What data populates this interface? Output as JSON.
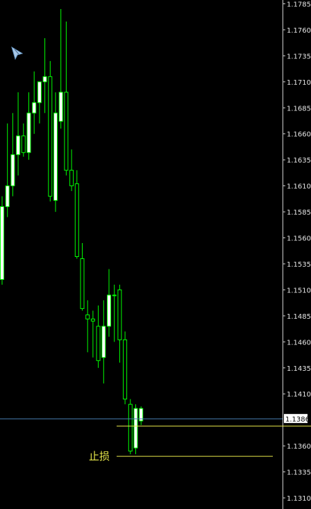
{
  "chart_data": {
    "type": "candlestick",
    "ylim": [
      1.13,
      1.179
    ],
    "y_ticks": [
      "1.1785",
      "1.1760",
      "1.1735",
      "1.1710",
      "1.1685",
      "1.1660",
      "1.1635",
      "1.1610",
      "1.1585",
      "1.1560",
      "1.1535",
      "1.1510",
      "1.1485",
      "1.1460",
      "1.1435",
      "1.1410",
      "1.1386",
      "1.1360",
      "1.1335",
      "1.1310"
    ],
    "current_price": "1.1386",
    "stop_loss_label": "止损",
    "stop_loss_price": 1.135,
    "horizontal_line_price": 1.1379,
    "colors": {
      "up": "#ffffff",
      "down": "#000000",
      "wick": "#00ff00",
      "bid_line": "#4a7fb5",
      "level_line": "#e8e84a",
      "background": "#000000"
    },
    "candles": [
      {
        "o": 1.152,
        "h": 1.16,
        "l": 1.1515,
        "c": 1.159
      },
      {
        "o": 1.159,
        "h": 1.167,
        "l": 1.158,
        "c": 1.161
      },
      {
        "o": 1.161,
        "h": 1.168,
        "l": 1.16,
        "c": 1.164
      },
      {
        "o": 1.164,
        "h": 1.17,
        "l": 1.162,
        "c": 1.1658
      },
      {
        "o": 1.1658,
        "h": 1.167,
        "l": 1.1638,
        "c": 1.1642
      },
      {
        "o": 1.1642,
        "h": 1.17,
        "l": 1.1635,
        "c": 1.168
      },
      {
        "o": 1.168,
        "h": 1.172,
        "l": 1.166,
        "c": 1.169
      },
      {
        "o": 1.169,
        "h": 1.171,
        "l": 1.167,
        "c": 1.171
      },
      {
        "o": 1.171,
        "h": 1.1752,
        "l": 1.168,
        "c": 1.1715
      },
      {
        "o": 1.1715,
        "h": 1.173,
        "l": 1.1595,
        "c": 1.16
      },
      {
        "o": 1.1596,
        "h": 1.17,
        "l": 1.1585,
        "c": 1.168
      },
      {
        "o": 1.1672,
        "h": 1.178,
        "l": 1.1665,
        "c": 1.17
      },
      {
        "o": 1.17,
        "h": 1.1768,
        "l": 1.162,
        "c": 1.1625
      },
      {
        "o": 1.1625,
        "h": 1.1645,
        "l": 1.1605,
        "c": 1.161
      },
      {
        "o": 1.1612,
        "h": 1.1625,
        "l": 1.154,
        "c": 1.1542
      },
      {
        "o": 1.154,
        "h": 1.1555,
        "l": 1.149,
        "c": 1.1492
      },
      {
        "o": 1.1486,
        "h": 1.15,
        "l": 1.145,
        "c": 1.1482
      },
      {
        "o": 1.1482,
        "h": 1.149,
        "l": 1.1445,
        "c": 1.148
      },
      {
        "o": 1.1475,
        "h": 1.1495,
        "l": 1.1435,
        "c": 1.1442
      },
      {
        "o": 1.1445,
        "h": 1.15,
        "l": 1.142,
        "c": 1.1475
      },
      {
        "o": 1.1475,
        "h": 1.153,
        "l": 1.1465,
        "c": 1.1505
      },
      {
        "o": 1.1505,
        "h": 1.1515,
        "l": 1.146,
        "c": 1.1505
      },
      {
        "o": 1.151,
        "h": 1.1515,
        "l": 1.144,
        "c": 1.1462
      },
      {
        "o": 1.1462,
        "h": 1.147,
        "l": 1.14,
        "c": 1.1405
      },
      {
        "o": 1.14,
        "h": 1.1405,
        "l": 1.1352,
        "c": 1.1355
      },
      {
        "o": 1.1358,
        "h": 1.14,
        "l": 1.1352,
        "c": 1.1396
      },
      {
        "o": 1.1384,
        "h": 1.1398,
        "l": 1.138,
        "c": 1.1396
      }
    ]
  }
}
